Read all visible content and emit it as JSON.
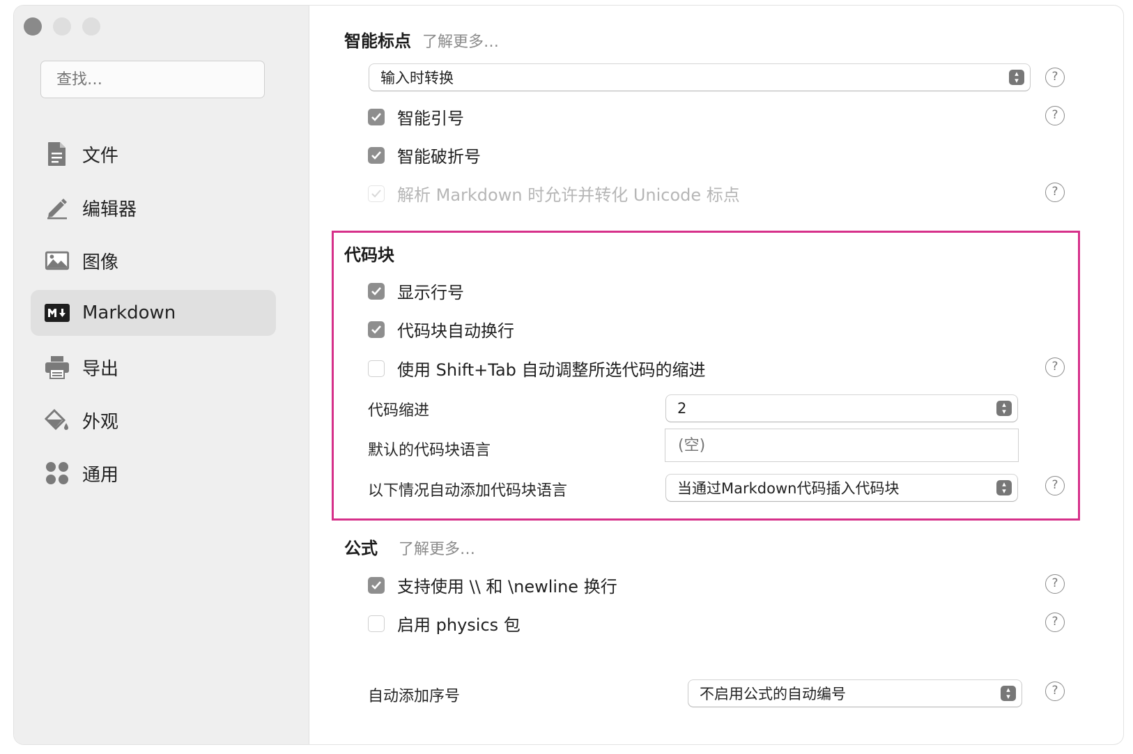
{
  "sidebar": {
    "search_placeholder": "查找…",
    "items": [
      {
        "label": "文件",
        "icon": "file-icon"
      },
      {
        "label": "编辑器",
        "icon": "pencil-icon"
      },
      {
        "label": "图像",
        "icon": "image-icon"
      },
      {
        "label": "Markdown",
        "icon": "markdown-icon",
        "active": true
      },
      {
        "label": "导出",
        "icon": "printer-icon"
      },
      {
        "label": "外观",
        "icon": "paint-bucket-icon"
      },
      {
        "label": "通用",
        "icon": "grid-icon"
      }
    ]
  },
  "smart_punct": {
    "title": "智能标点",
    "learn_more": "了解更多…",
    "mode_value": "输入时转换",
    "smart_quotes": "智能引号",
    "smart_dashes": "智能破折号",
    "unicode_punct": "解析 Markdown 时允许并转化 Unicode 标点"
  },
  "code_block": {
    "title": "代码块",
    "show_line_numbers": "显示行号",
    "auto_wrap": "代码块自动换行",
    "shift_tab": "使用 Shift+Tab 自动调整所选代码的缩进",
    "indent_label": "代码缩进",
    "indent_value": "2",
    "default_lang_label": "默认的代码块语言",
    "default_lang_placeholder": "(空)",
    "auto_lang_label": "以下情况自动添加代码块语言",
    "auto_lang_value": "当通过Markdown代码插入代码块"
  },
  "math": {
    "title": "公式",
    "learn_more": "了解更多…",
    "newline_support": "支持使用 \\\\ 和 \\newline 换行",
    "physics": "启用 physics 包",
    "auto_number_label": "自动添加序号",
    "auto_number_value": "不启用公式的自动编号"
  },
  "help_glyph": "?",
  "colors": {
    "highlight": "#d6308a",
    "sidebar_bg": "#efefef",
    "checkbox_on": "#8e8e8e"
  }
}
